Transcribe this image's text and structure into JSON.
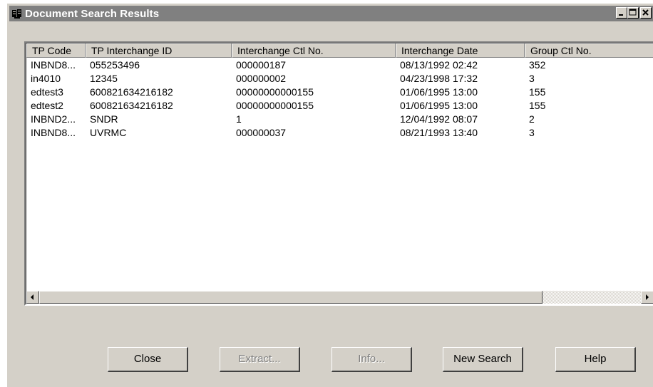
{
  "window": {
    "title": "Document Search Results",
    "controls": [
      "minimize",
      "maximize",
      "close"
    ]
  },
  "table": {
    "columns": [
      "TP Code",
      "TP Interchange ID",
      "Interchange Ctl No.",
      "Interchange Date",
      "Group Ctl No."
    ],
    "rows": [
      [
        "INBND8...",
        "055253496",
        "000000187",
        "08/13/1992 02:42",
        "352"
      ],
      [
        "in4010",
        "12345",
        "000000002",
        "04/23/1998 17:32",
        "3"
      ],
      [
        "edtest3",
        "600821634216182",
        "00000000000155",
        "01/06/1995 13:00",
        "155"
      ],
      [
        "edtest2",
        "600821634216182",
        "00000000000155",
        "01/06/1995 13:00",
        "155"
      ],
      [
        "INBND2...",
        "SNDR",
        "1",
        "12/04/1992 08:07",
        "2"
      ],
      [
        "INBND8...",
        "UVRMC",
        "000000037",
        "08/21/1993 13:40",
        "3"
      ]
    ]
  },
  "buttons": {
    "close": "Close",
    "extract": "Extract...",
    "info": "Info...",
    "new_search": "New Search",
    "help": "Help"
  }
}
